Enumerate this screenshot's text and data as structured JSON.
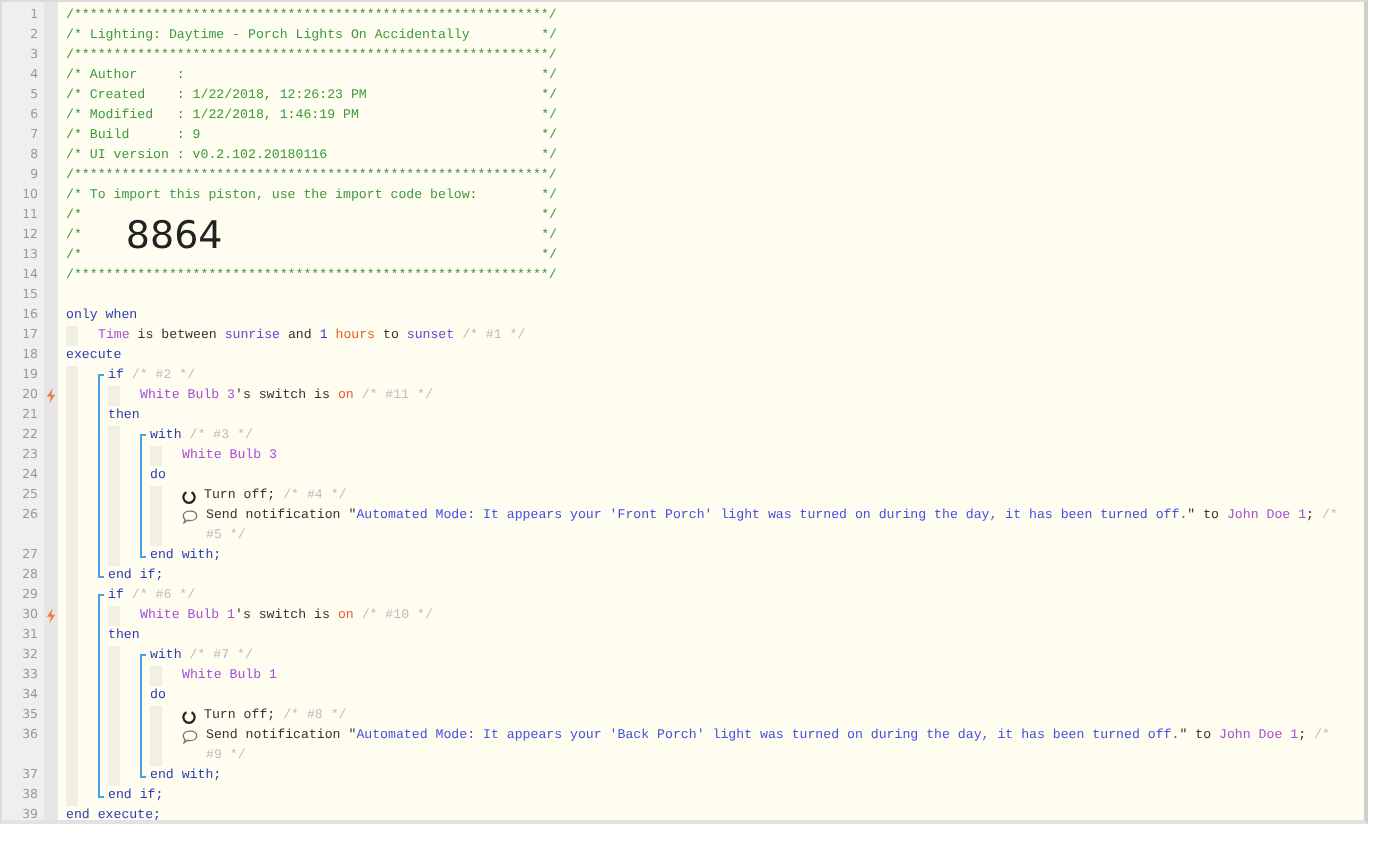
{
  "editor": {
    "lines": [
      {
        "kind": "banner",
        "number": "1",
        "trigger": false,
        "tokens": [
          {
            "kind": "comment",
            "text": "/************************************************************/"
          }
        ]
      },
      {
        "kind": "banner",
        "number": "2",
        "trigger": false,
        "tokens": [
          {
            "kind": "comment",
            "text": "/* Lighting: Daytime - Porch Lights On Accidentally"
          },
          {
            "kind": "comment",
            "text": "*/"
          }
        ]
      },
      {
        "kind": "banner",
        "number": "3",
        "trigger": false,
        "tokens": [
          {
            "kind": "comment",
            "text": "/************************************************************/"
          }
        ]
      },
      {
        "kind": "banner",
        "number": "4",
        "trigger": false,
        "tokens": [
          {
            "kind": "comment",
            "text": "/* Author     :"
          },
          {
            "kind": "comment",
            "text": "*/"
          }
        ]
      },
      {
        "kind": "banner",
        "number": "5",
        "trigger": false,
        "tokens": [
          {
            "kind": "comment",
            "text": "/* Created    : 1/22/2018, 12:26:23 PM"
          },
          {
            "kind": "comment",
            "text": "*/"
          }
        ]
      },
      {
        "kind": "banner",
        "number": "6",
        "trigger": false,
        "tokens": [
          {
            "kind": "comment",
            "text": "/* Modified   : 1/22/2018, 1:46:19 PM"
          },
          {
            "kind": "comment",
            "text": "*/"
          }
        ]
      },
      {
        "kind": "banner",
        "number": "7",
        "trigger": false,
        "tokens": [
          {
            "kind": "comment",
            "text": "/* Build      : 9"
          },
          {
            "kind": "comment",
            "text": "*/"
          }
        ]
      },
      {
        "kind": "banner",
        "number": "8",
        "trigger": false,
        "tokens": [
          {
            "kind": "comment",
            "text": "/* UI version : v0.2.102.20180116"
          },
          {
            "kind": "comment",
            "text": "*/"
          }
        ]
      },
      {
        "kind": "banner",
        "number": "9",
        "trigger": false,
        "tokens": [
          {
            "kind": "comment",
            "text": "/************************************************************/"
          }
        ]
      },
      {
        "kind": "banner",
        "number": "10",
        "trigger": false,
        "tokens": [
          {
            "kind": "comment",
            "text": "/* To import this piston, use the import code below:"
          },
          {
            "kind": "comment",
            "text": "*/"
          }
        ]
      },
      {
        "kind": "banner",
        "number": "11",
        "trigger": false,
        "tokens": [
          {
            "kind": "comment",
            "text": "/*"
          },
          {
            "kind": "comment",
            "text": "*/"
          }
        ]
      },
      {
        "kind": "banner",
        "number": "12",
        "trigger": false,
        "tokens": [
          {
            "kind": "comment",
            "text": "/*"
          },
          {
            "kind": "import_code",
            "text": "8864"
          },
          {
            "kind": "comment",
            "text": "*/"
          }
        ]
      },
      {
        "kind": "banner",
        "number": "13",
        "trigger": false,
        "tokens": [
          {
            "kind": "comment",
            "text": "/*"
          },
          {
            "kind": "comment",
            "text": "*/"
          }
        ]
      },
      {
        "kind": "banner",
        "number": "14",
        "trigger": false,
        "tokens": [
          {
            "kind": "comment",
            "text": "/************************************************************/"
          }
        ]
      },
      {
        "kind": "blank",
        "number": "15",
        "trigger": false
      },
      {
        "kind": "code",
        "number": "16",
        "trigger": false,
        "tokens": [
          {
            "kind": "keyword",
            "text": "only when"
          }
        ],
        "children": [
          {
            "kind": "code",
            "number": "17",
            "trigger": false,
            "tokens": [
              {
                "kind": "device",
                "text": "Time"
              },
              {
                "kind": "text",
                "text": " is between "
              },
              {
                "kind": "value",
                "text": "sunrise"
              },
              {
                "kind": "text",
                "text": " and "
              },
              {
                "kind": "number",
                "text": "1 "
              },
              {
                "kind": "highlight",
                "text": "hours"
              },
              {
                "kind": "text",
                "text": " to "
              },
              {
                "kind": "value",
                "text": "sunset"
              },
              {
                "kind": "note",
                "text": " /* #1 */"
              }
            ]
          }
        ]
      },
      {
        "kind": "code",
        "number": "18",
        "trigger": false,
        "tokens": [
          {
            "kind": "keyword",
            "text": "execute"
          }
        ],
        "children": [
          {
            "kind": "block",
            "nodes": [
              {
                "kind": "code",
                "number": "19",
                "trigger": false,
                "tokens": [
                  {
                    "kind": "keyword",
                    "text": "if"
                  },
                  {
                    "kind": "note",
                    "text": " /* #2 */"
                  }
                ],
                "children": [
                  {
                    "kind": "code",
                    "number": "20",
                    "trigger": true,
                    "tokens": [
                      {
                        "kind": "device",
                        "text": "White Bulb 3"
                      },
                      {
                        "kind": "text",
                        "text": "'s switch is "
                      },
                      {
                        "kind": "highlight",
                        "text": "on"
                      },
                      {
                        "kind": "note",
                        "text": " /* #11 */"
                      }
                    ]
                  }
                ]
              },
              {
                "kind": "code",
                "number": "21",
                "trigger": false,
                "tokens": [
                  {
                    "kind": "keyword",
                    "text": "then"
                  }
                ],
                "children": [
                  {
                    "kind": "block",
                    "nodes": [
                      {
                        "kind": "code",
                        "number": "22",
                        "trigger": false,
                        "tokens": [
                          {
                            "kind": "keyword",
                            "text": "with"
                          },
                          {
                            "kind": "note",
                            "text": " /* #3 */"
                          }
                        ],
                        "children": [
                          {
                            "kind": "code",
                            "number": "23",
                            "trigger": false,
                            "tokens": [
                              {
                                "kind": "device",
                                "text": "White Bulb 3"
                              }
                            ]
                          }
                        ]
                      },
                      {
                        "kind": "code",
                        "number": "24",
                        "trigger": false,
                        "tokens": [
                          {
                            "kind": "keyword",
                            "text": "do"
                          }
                        ],
                        "children": [
                          {
                            "kind": "command",
                            "number": "25",
                            "trigger": false,
                            "tokens": [
                              {
                                "kind": "text",
                                "text": "Turn off;"
                              },
                              {
                                "kind": "note",
                                "text": " /* #4 */"
                              }
                            ]
                          },
                          {
                            "kind": "notification",
                            "number": "26",
                            "trigger": false,
                            "tokens": [
                              {
                                "kind": "text",
                                "text": "Send notification \""
                              },
                              {
                                "kind": "string",
                                "text": "Automated Mode: It appears your 'Front Porch' light was turned on during the day, it has been turned off."
                              },
                              {
                                "kind": "text",
                                "text": "\" to "
                              },
                              {
                                "kind": "device",
                                "text": "John Doe 1"
                              },
                              {
                                "kind": "text",
                                "text": ";"
                              },
                              {
                                "kind": "note",
                                "text": " /* #5 */"
                              }
                            ]
                          }
                        ]
                      },
                      {
                        "kind": "code",
                        "number": "27",
                        "trigger": false,
                        "tokens": [
                          {
                            "kind": "keyword",
                            "text": "end with;"
                          }
                        ]
                      }
                    ]
                  }
                ]
              },
              {
                "kind": "code",
                "number": "28",
                "trigger": false,
                "tokens": [
                  {
                    "kind": "keyword",
                    "text": "end if;"
                  }
                ]
              }
            ]
          },
          {
            "kind": "block",
            "nodes": [
              {
                "kind": "code",
                "number": "29",
                "trigger": false,
                "tokens": [
                  {
                    "kind": "keyword",
                    "text": "if"
                  },
                  {
                    "kind": "note",
                    "text": " /* #6 */"
                  }
                ],
                "children": [
                  {
                    "kind": "code",
                    "number": "30",
                    "trigger": true,
                    "tokens": [
                      {
                        "kind": "device",
                        "text": "White Bulb 1"
                      },
                      {
                        "kind": "text",
                        "text": "'s switch is "
                      },
                      {
                        "kind": "highlight",
                        "text": "on"
                      },
                      {
                        "kind": "note",
                        "text": " /* #10 */"
                      }
                    ]
                  }
                ]
              },
              {
                "kind": "code",
                "number": "31",
                "trigger": false,
                "tokens": [
                  {
                    "kind": "keyword",
                    "text": "then"
                  }
                ],
                "children": [
                  {
                    "kind": "block",
                    "nodes": [
                      {
                        "kind": "code",
                        "number": "32",
                        "trigger": false,
                        "tokens": [
                          {
                            "kind": "keyword",
                            "text": "with"
                          },
                          {
                            "kind": "note",
                            "text": " /* #7 */"
                          }
                        ],
                        "children": [
                          {
                            "kind": "code",
                            "number": "33",
                            "trigger": false,
                            "tokens": [
                              {
                                "kind": "device",
                                "text": "White Bulb 1"
                              }
                            ]
                          }
                        ]
                      },
                      {
                        "kind": "code",
                        "number": "34",
                        "trigger": false,
                        "tokens": [
                          {
                            "kind": "keyword",
                            "text": "do"
                          }
                        ],
                        "children": [
                          {
                            "kind": "command",
                            "number": "35",
                            "trigger": false,
                            "tokens": [
                              {
                                "kind": "text",
                                "text": "Turn off;"
                              },
                              {
                                "kind": "note",
                                "text": " /* #8 */"
                              }
                            ]
                          },
                          {
                            "kind": "notification",
                            "number": "36",
                            "trigger": false,
                            "tokens": [
                              {
                                "kind": "text",
                                "text": "Send notification \""
                              },
                              {
                                "kind": "string",
                                "text": "Automated Mode: It appears your 'Back Porch' light was turned on during the day, it has been turned off."
                              },
                              {
                                "kind": "text",
                                "text": "\" to "
                              },
                              {
                                "kind": "device",
                                "text": "John Doe 1"
                              },
                              {
                                "kind": "text",
                                "text": ";"
                              },
                              {
                                "kind": "note",
                                "text": " /* #9 */"
                              }
                            ]
                          }
                        ]
                      },
                      {
                        "kind": "code",
                        "number": "37",
                        "trigger": false,
                        "tokens": [
                          {
                            "kind": "keyword",
                            "text": "end with;"
                          }
                        ]
                      }
                    ]
                  }
                ]
              },
              {
                "kind": "code",
                "number": "38",
                "trigger": false,
                "tokens": [
                  {
                    "kind": "keyword",
                    "text": "end if;"
                  }
                ]
              }
            ]
          }
        ]
      },
      {
        "kind": "code",
        "number": "39",
        "trigger": false,
        "tokens": [
          {
            "kind": "keyword",
            "text": "end execute;"
          }
        ]
      }
    ]
  }
}
